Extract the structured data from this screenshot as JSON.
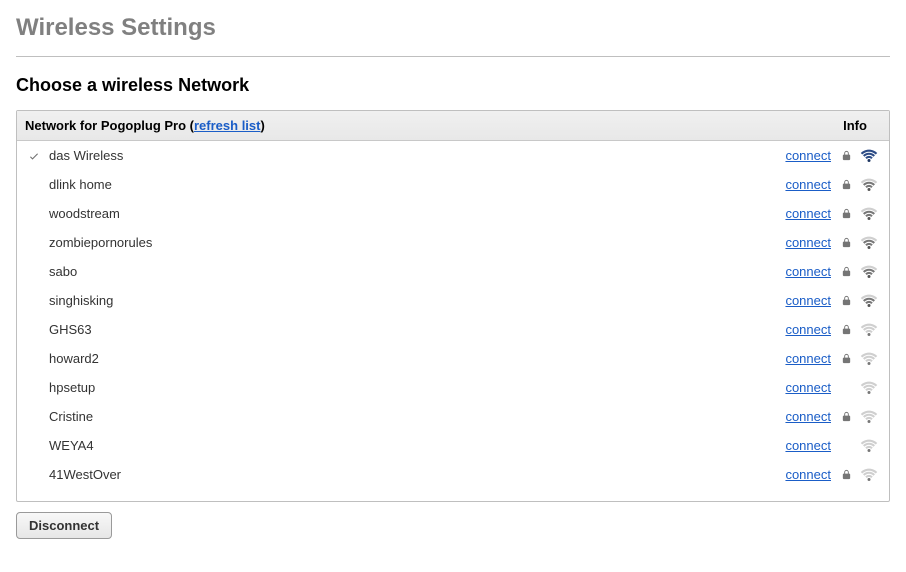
{
  "page_title": "Wireless Settings",
  "section_title": "Choose a wireless Network",
  "panel": {
    "header_prefix": "Network for Pogoplug Pro (",
    "refresh_label": "refresh list",
    "header_suffix": ")",
    "info_label": "Info",
    "connect_label": "connect"
  },
  "networks": [
    {
      "ssid": "das Wireless",
      "selected": true,
      "secured": true,
      "signal": 3
    },
    {
      "ssid": "dlink home",
      "selected": false,
      "secured": true,
      "signal": 2
    },
    {
      "ssid": "woodstream",
      "selected": false,
      "secured": true,
      "signal": 2
    },
    {
      "ssid": "zombiepornorules",
      "selected": false,
      "secured": true,
      "signal": 2
    },
    {
      "ssid": "sabo",
      "selected": false,
      "secured": true,
      "signal": 2
    },
    {
      "ssid": "singhisking",
      "selected": false,
      "secured": true,
      "signal": 2
    },
    {
      "ssid": "GHS63",
      "selected": false,
      "secured": true,
      "signal": 1
    },
    {
      "ssid": "howard2",
      "selected": false,
      "secured": true,
      "signal": 1
    },
    {
      "ssid": "hpsetup",
      "selected": false,
      "secured": false,
      "signal": 1
    },
    {
      "ssid": "Cristine",
      "selected": false,
      "secured": true,
      "signal": 1
    },
    {
      "ssid": "WEYA4",
      "selected": false,
      "secured": false,
      "signal": 1
    },
    {
      "ssid": "41WestOver",
      "selected": false,
      "secured": true,
      "signal": 1
    }
  ],
  "disconnect_label": "Disconnect"
}
